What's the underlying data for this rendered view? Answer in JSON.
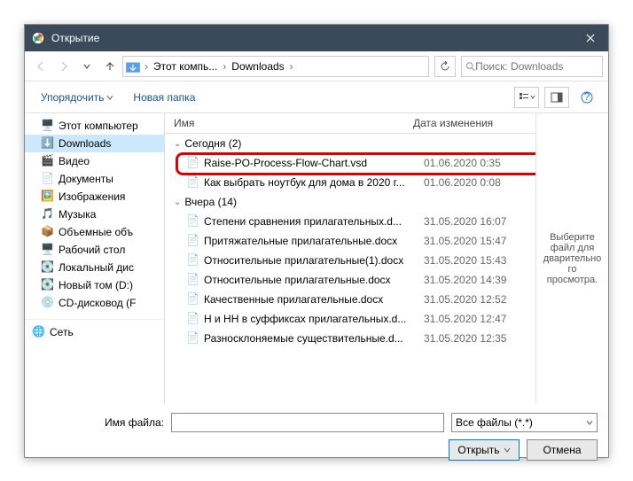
{
  "window": {
    "title": "Открытие"
  },
  "nav": {
    "breadcrumb": [
      "Этот компь...",
      "Downloads"
    ],
    "search_placeholder": "Поиск: Downloads"
  },
  "toolbar": {
    "organize": "Упорядочить",
    "new_folder": "Новая папка"
  },
  "sidebar": {
    "items": [
      {
        "label": "Этот компьютер",
        "icon": "pc"
      },
      {
        "label": "Downloads",
        "icon": "downloads",
        "selected": true
      },
      {
        "label": "Видео",
        "icon": "video"
      },
      {
        "label": "Документы",
        "icon": "docs"
      },
      {
        "label": "Изображения",
        "icon": "pics"
      },
      {
        "label": "Музыка",
        "icon": "music"
      },
      {
        "label": "Объемные объ",
        "icon": "3d"
      },
      {
        "label": "Рабочий стол",
        "icon": "desktop"
      },
      {
        "label": "Локальный дис",
        "icon": "disk"
      },
      {
        "label": "Новый том (D:)",
        "icon": "disk"
      },
      {
        "label": "CD-дисковод (F",
        "icon": "cd"
      }
    ],
    "network": "Сеть"
  },
  "filelist": {
    "col_name": "Имя",
    "col_date": "Дата изменения",
    "groups": [
      {
        "label": "Сегодня (2)",
        "files": [
          {
            "name": "Raise-PO-Process-Flow-Chart.vsd",
            "date": "01.06.2020 0:35",
            "type": "file",
            "highlighted": true
          },
          {
            "name": "Как выбрать ноутбук для дома в 2020 г...",
            "date": "01.06.2020 0:08",
            "type": "doc"
          }
        ]
      },
      {
        "label": "Вчера (14)",
        "files": [
          {
            "name": "Степени сравнения прилагательных.d...",
            "date": "31.05.2020 16:07",
            "type": "doc"
          },
          {
            "name": "Притяжательные прилагательные.docx",
            "date": "31.05.2020 15:47",
            "type": "doc"
          },
          {
            "name": "Относительные прилагательные(1).docx",
            "date": "31.05.2020 15:43",
            "type": "doc"
          },
          {
            "name": "Относительные прилагательные.docx",
            "date": "31.05.2020 14:39",
            "type": "doc"
          },
          {
            "name": "Качественные прилагательные.docx",
            "date": "31.05.2020 12:52",
            "type": "doc"
          },
          {
            "name": "Н и НН в суффиксах прилагательных.d...",
            "date": "31.05.2020 12:47",
            "type": "doc"
          },
          {
            "name": "Разносклоняемые существительные.d...",
            "date": "31.05.2020 12:35",
            "type": "doc"
          }
        ]
      }
    ]
  },
  "preview": {
    "text": "Выберите файл для дварительного просмотра."
  },
  "footer": {
    "filename_label": "Имя файла:",
    "filename_value": "",
    "filter": "Все файлы (*.*)",
    "open": "Открыть",
    "cancel": "Отмена"
  },
  "icons": {
    "pc": "🖥️",
    "downloads": "⬇️",
    "video": "🎬",
    "docs": "📄",
    "pics": "🖼️",
    "music": "🎵",
    "3d": "📦",
    "desktop": "🖥️",
    "disk": "💽",
    "cd": "💿",
    "network": "🌐",
    "file": "📄",
    "doc": "📄"
  }
}
